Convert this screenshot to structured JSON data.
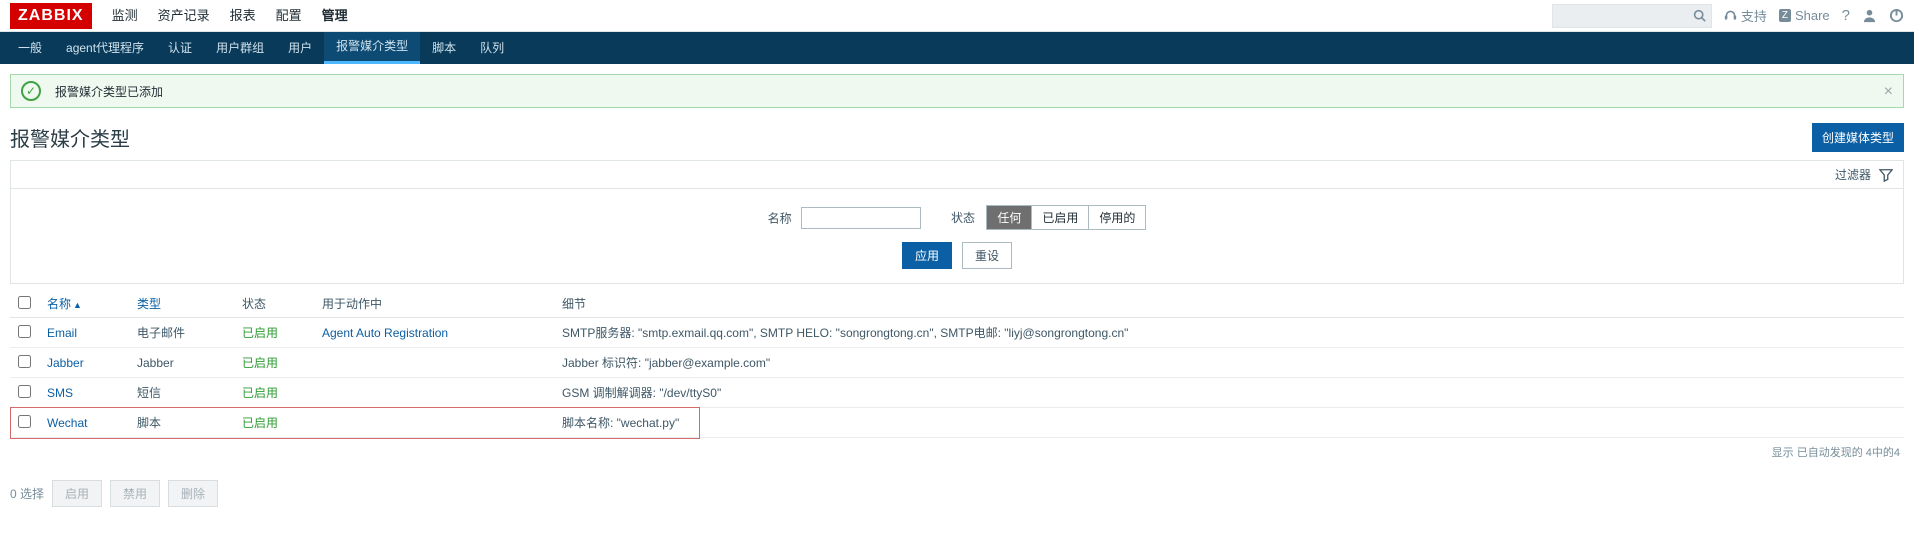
{
  "topnav": {
    "logo": "ZABBIX",
    "items": [
      "监测",
      "资产记录",
      "报表",
      "配置",
      "管理"
    ],
    "active": 4,
    "search_placeholder": "",
    "support": "支持",
    "share": "Share"
  },
  "subnav": {
    "items": [
      "一般",
      "agent代理程序",
      "认证",
      "用户群组",
      "用户",
      "报警媒介类型",
      "脚本",
      "队列"
    ],
    "active": 5
  },
  "message": "报警媒介类型已添加",
  "page_title": "报警媒介类型",
  "create_button": "创建媒体类型",
  "filter": {
    "toggle": "过滤器",
    "name_label": "名称",
    "name_value": "",
    "status_label": "状态",
    "seg": [
      "任何",
      "已启用",
      "停用的"
    ],
    "seg_active": 0,
    "apply": "应用",
    "reset": "重设"
  },
  "table": {
    "headers": {
      "name": "名称",
      "type": "类型",
      "status": "状态",
      "usedin": "用于动作中",
      "details": "细节"
    },
    "rows": [
      {
        "name": "Email",
        "type": "电子邮件",
        "status": "已启用",
        "action": "Agent Auto Registration",
        "details": "SMTP服务器: \"smtp.exmail.qq.com\", SMTP HELO: \"songrongtong.cn\", SMTP电邮: \"liyj@songrongtong.cn\"",
        "hl": false
      },
      {
        "name": "Jabber",
        "type": "Jabber",
        "status": "已启用",
        "action": "",
        "details": "Jabber 标识符: \"jabber@example.com\"",
        "hl": false
      },
      {
        "name": "SMS",
        "type": "短信",
        "status": "已启用",
        "action": "",
        "details": "GSM 调制解调器: \"/dev/ttyS0\"",
        "hl": false
      },
      {
        "name": "Wechat",
        "type": "脚本",
        "status": "已启用",
        "action": "",
        "details": "脚本名称: \"wechat.py\"",
        "hl": true
      }
    ],
    "footer": "显示 已自动发现的 4中的4"
  },
  "bulk": {
    "selected": "0 选择",
    "enable": "启用",
    "disable": "禁用",
    "delete": "删除"
  }
}
